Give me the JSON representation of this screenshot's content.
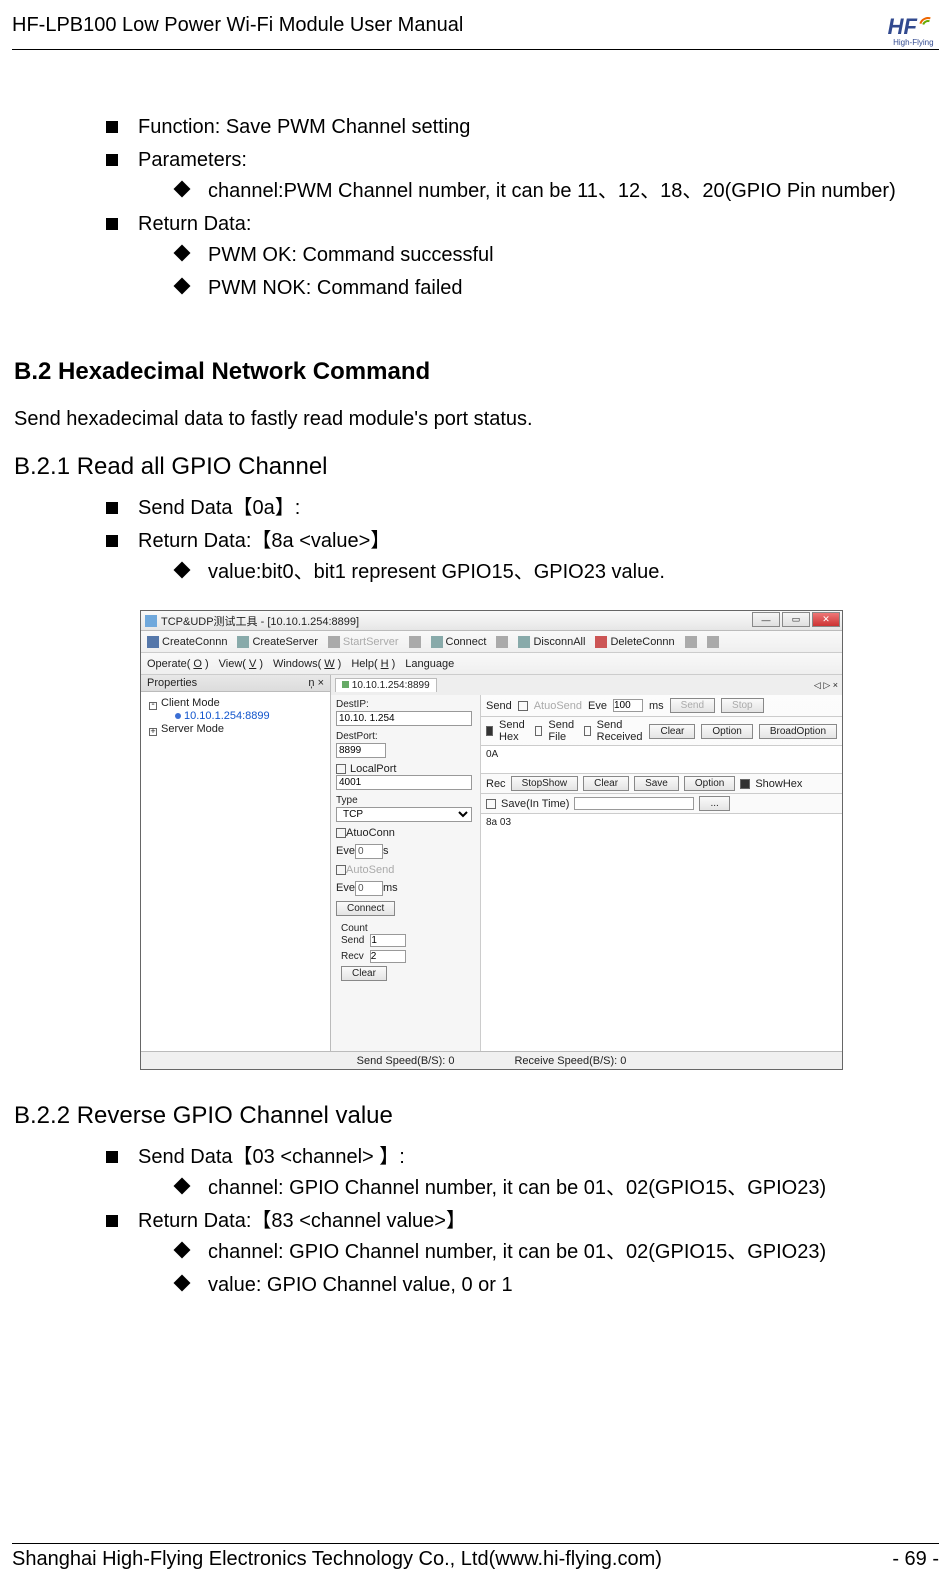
{
  "header": {
    "title": "HF-LPB100 Low Power Wi-Fi Module User Manual",
    "logo_text": "HF",
    "logo_sub": "High-Flying"
  },
  "top_list": {
    "function": "Function: Save PWM  Channel setting",
    "parameters_label": "Parameters:",
    "parameters_item": "channel:PWM Channel number, it can be 11、12、18、20(GPIO Pin number)",
    "return_label": "Return Data:",
    "return_ok": "PWM OK: Command successful",
    "return_nok": "PWM NOK: Command failed"
  },
  "b2": {
    "heading": "B.2  Hexadecimal Network Command",
    "intro": "Send hexadecimal data to fastly read module's port status."
  },
  "b21": {
    "heading": "B.2.1    Read all GPIO Channel",
    "send": "Send Data【0a】:",
    "return_label": "Return Data:【8a <value>】",
    "value_desc": "value:bit0、bit1 represent GPIO15、GPIO23 value."
  },
  "app": {
    "title": "TCP&UDP测试工具 - [10.10.1.254:8899]",
    "toolbar1": {
      "createconn": "CreateConnn",
      "createserver": "CreateServer",
      "startserver": "StartServer",
      "connect": "Connect",
      "disconnall": "DisconnAll",
      "deleteconn": "DeleteConnn"
    },
    "menubar": {
      "operate": "Operate(O)",
      "view": "View(V)",
      "windows": "Windows(W)",
      "help": "Help(H)",
      "language": "Language"
    },
    "properties_header": "Properties",
    "pin": "ņ ×",
    "tree": {
      "client_mode": "Client Mode",
      "conn": "10.10.1.254:8899",
      "server_mode": "Server Mode"
    },
    "tab": "10.10.1.254:8899",
    "tab_nav": "◁ ▷ ×",
    "mid": {
      "destip_label": "DestIP:",
      "destip_value": "10.10. 1.254",
      "destport_label": "DestPort:",
      "destport_value": "8899",
      "localport_chk": "LocalPort",
      "localport_value": "4001",
      "type_label": "Type",
      "type_value": "TCP",
      "atuoconn": "AtuoConn",
      "eve1_label": "Eve",
      "eve1_value": "0",
      "eve1_unit": "s",
      "autosend": "AutoSend",
      "eve2_label": "Eve",
      "eve2_value": "0",
      "eve2_unit": "ms",
      "connect_btn": "Connect",
      "count_label": "Count",
      "send_label": "Send",
      "send_value": "1",
      "recv_label": "Recv",
      "recv_value": "2",
      "clear_btn": "Clear"
    },
    "out": {
      "send_label": "Send",
      "atuosend_chk": "AtuoSend",
      "eve_label": "Eve",
      "eve_value": "100",
      "ms": "ms",
      "send_btn": "Send",
      "stop_btn": "Stop",
      "sendhex_chk": "Send Hex",
      "sendfile_chk": "Send File",
      "sendreceived_chk": "Send Received",
      "clear_btn": "Clear",
      "option_btn": "Option",
      "broad_btn": "BroadOption",
      "send_box": "0A",
      "rec_label": "Rec",
      "stopshow_btn": "StopShow",
      "clear2_btn": "Clear",
      "save_btn": "Save",
      "option2_btn": "Option",
      "showhex_chk": "ShowHex",
      "save_in_time_chk": "Save(In Time)",
      "recv_box": "8a 03"
    },
    "status": {
      "send_speed": "Send Speed(B/S): 0",
      "recv_speed": "Receive Speed(B/S): 0"
    }
  },
  "b22": {
    "heading": "B.2.2    Reverse GPIO Channel value",
    "send_label": "Send Data【03 <channel> 】:",
    "send_channel": "channel: GPIO Channel number, it can be 01、02(GPIO15、GPIO23)",
    "return_label": "Return Data:【83 <channel value>】",
    "return_channel": "channel: GPIO Channel number, it can be 01、02(GPIO15、GPIO23)",
    "return_value": "value: GPIO Channel value, 0 or 1"
  },
  "footer": {
    "company": "Shanghai High-Flying Electronics Technology Co., Ltd(www.hi-flying.com)",
    "page": "- 69 -"
  }
}
